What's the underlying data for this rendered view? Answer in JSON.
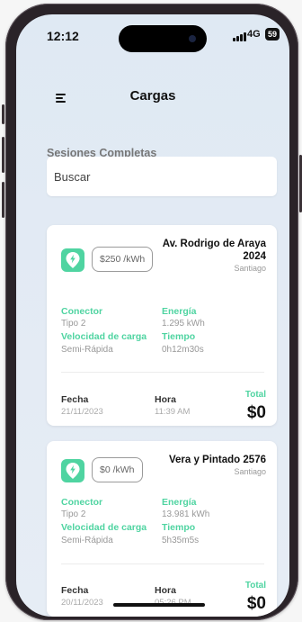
{
  "status_bar": {
    "time": "12:12",
    "network": "4G",
    "battery": "59"
  },
  "header": {
    "title": "Cargas",
    "menu_icon": "hamburger-menu-icon"
  },
  "section": {
    "title": "Sesiones Completas"
  },
  "search": {
    "placeholder": "Buscar"
  },
  "labels": {
    "connector": "Conector",
    "energy": "Energía",
    "speed": "Velocidad de carga",
    "time": "Tiempo",
    "date": "Fecha",
    "hour": "Hora",
    "total": "Total"
  },
  "sessions": [
    {
      "price": "$250 /kWh",
      "address": "Av. Rodrigo de Araya 2024",
      "address_line1": "Av. Rodrigo de Araya",
      "address_line2": "2024",
      "city": "Santiago",
      "connector": "Tipo 2",
      "energy": "1.295 kWh",
      "speed": "Semi-Rápida",
      "duration": "0h12m30s",
      "date": "21/11/2023",
      "hour": "11:39 AM",
      "total": "$0"
    },
    {
      "price": "$0 /kWh",
      "address": "Vera y Pintado 2576",
      "city": "Santiago",
      "connector": "Tipo 2",
      "energy": "13.981 kWh",
      "speed": "Semi-Rápida",
      "duration": "5h35m5s",
      "date": "20/11/2023",
      "hour": "05:26 PM",
      "total": "$0"
    }
  ],
  "colors": {
    "accent": "#4fd4a1",
    "background": "#e2eaf3"
  }
}
